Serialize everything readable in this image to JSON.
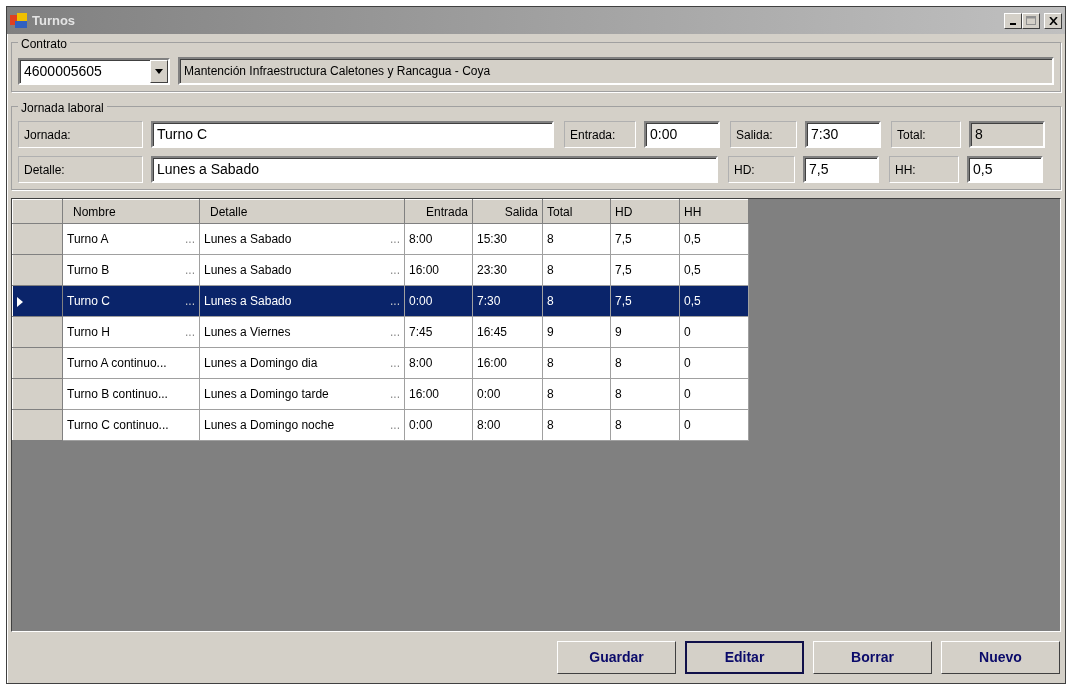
{
  "window": {
    "title": "Turnos"
  },
  "contrato": {
    "legend": "Contrato",
    "number": "4600005605",
    "description": "Mantención Infraestructura Caletones y  Rancagua - Coya"
  },
  "jornada_laboral": {
    "legend": "Jornada laboral",
    "fields": [
      {
        "label": "Jornada:",
        "value": "Turno C",
        "disabled": false,
        "kind": "wide"
      },
      {
        "label": "Entrada:",
        "value": "0:00",
        "disabled": false,
        "kind": "short"
      },
      {
        "label": "Salida:",
        "value": "7:30",
        "disabled": false,
        "kind": "short"
      },
      {
        "label": "Total:",
        "value": "8",
        "disabled": true,
        "kind": "short"
      },
      {
        "label": "Detalle:",
        "value": "Lunes a Sabado",
        "disabled": false,
        "kind": "extra-wide"
      },
      {
        "label": "HD:",
        "value": "7,5",
        "disabled": false,
        "kind": "short"
      },
      {
        "label": "HH:",
        "value": "0,5",
        "disabled": false,
        "kind": "short"
      }
    ]
  },
  "table": {
    "columns": [
      "Nombre",
      "Detalle",
      "Entrada",
      "Salida",
      "Total",
      "HD",
      "HH"
    ],
    "rows": [
      {
        "selected": false,
        "nombre": "Turno A",
        "nombre_button": "...",
        "detalle": "Lunes a Sabado",
        "detalle_button": "...",
        "entrada": "8:00",
        "salida": "15:30",
        "total": "8",
        "hd": "7,5",
        "hh": "0,5"
      },
      {
        "selected": false,
        "nombre": "Turno B",
        "nombre_button": "...",
        "detalle": "Lunes a Sabado",
        "detalle_button": "...",
        "entrada": "16:00",
        "salida": "23:30",
        "total": "8",
        "hd": "7,5",
        "hh": "0,5"
      },
      {
        "selected": true,
        "nombre": "Turno C",
        "nombre_button": "...",
        "detalle": "Lunes a Sabado",
        "detalle_button": "...",
        "entrada": "0:00",
        "salida": "7:30",
        "total": "8",
        "hd": "7,5",
        "hh": "0,5"
      },
      {
        "selected": false,
        "nombre": "Turno H",
        "nombre_button": "...",
        "detalle": "Lunes a Viernes",
        "detalle_button": "...",
        "entrada": "7:45",
        "salida": "16:45",
        "total": "9",
        "hd": "9",
        "hh": "0"
      },
      {
        "selected": false,
        "nombre": "Turno A continuo...",
        "detalle": "Lunes a Domingo dia",
        "detalle_button": "...",
        "entrada": "8:00",
        "salida": "16:00",
        "total": "8",
        "hd": "8",
        "hh": "0"
      },
      {
        "selected": false,
        "nombre": "Turno B continuo...",
        "detalle": "Lunes a Domingo tarde",
        "detalle_button": "...",
        "entrada": "16:00",
        "salida": "0:00",
        "total": "8",
        "hd": "8",
        "hh": "0"
      },
      {
        "selected": false,
        "nombre": "Turno C continuo...",
        "detalle": "Lunes a Domingo noche",
        "detalle_button": "...",
        "entrada": "0:00",
        "salida": "8:00",
        "total": "8",
        "hd": "8",
        "hh": "0"
      }
    ]
  },
  "buttons": [
    {
      "label": "Guardar",
      "focused": false
    },
    {
      "label": "Editar",
      "focused": true
    },
    {
      "label": "Borrar",
      "focused": false
    },
    {
      "label": "Nuevo",
      "focused": false
    }
  ]
}
